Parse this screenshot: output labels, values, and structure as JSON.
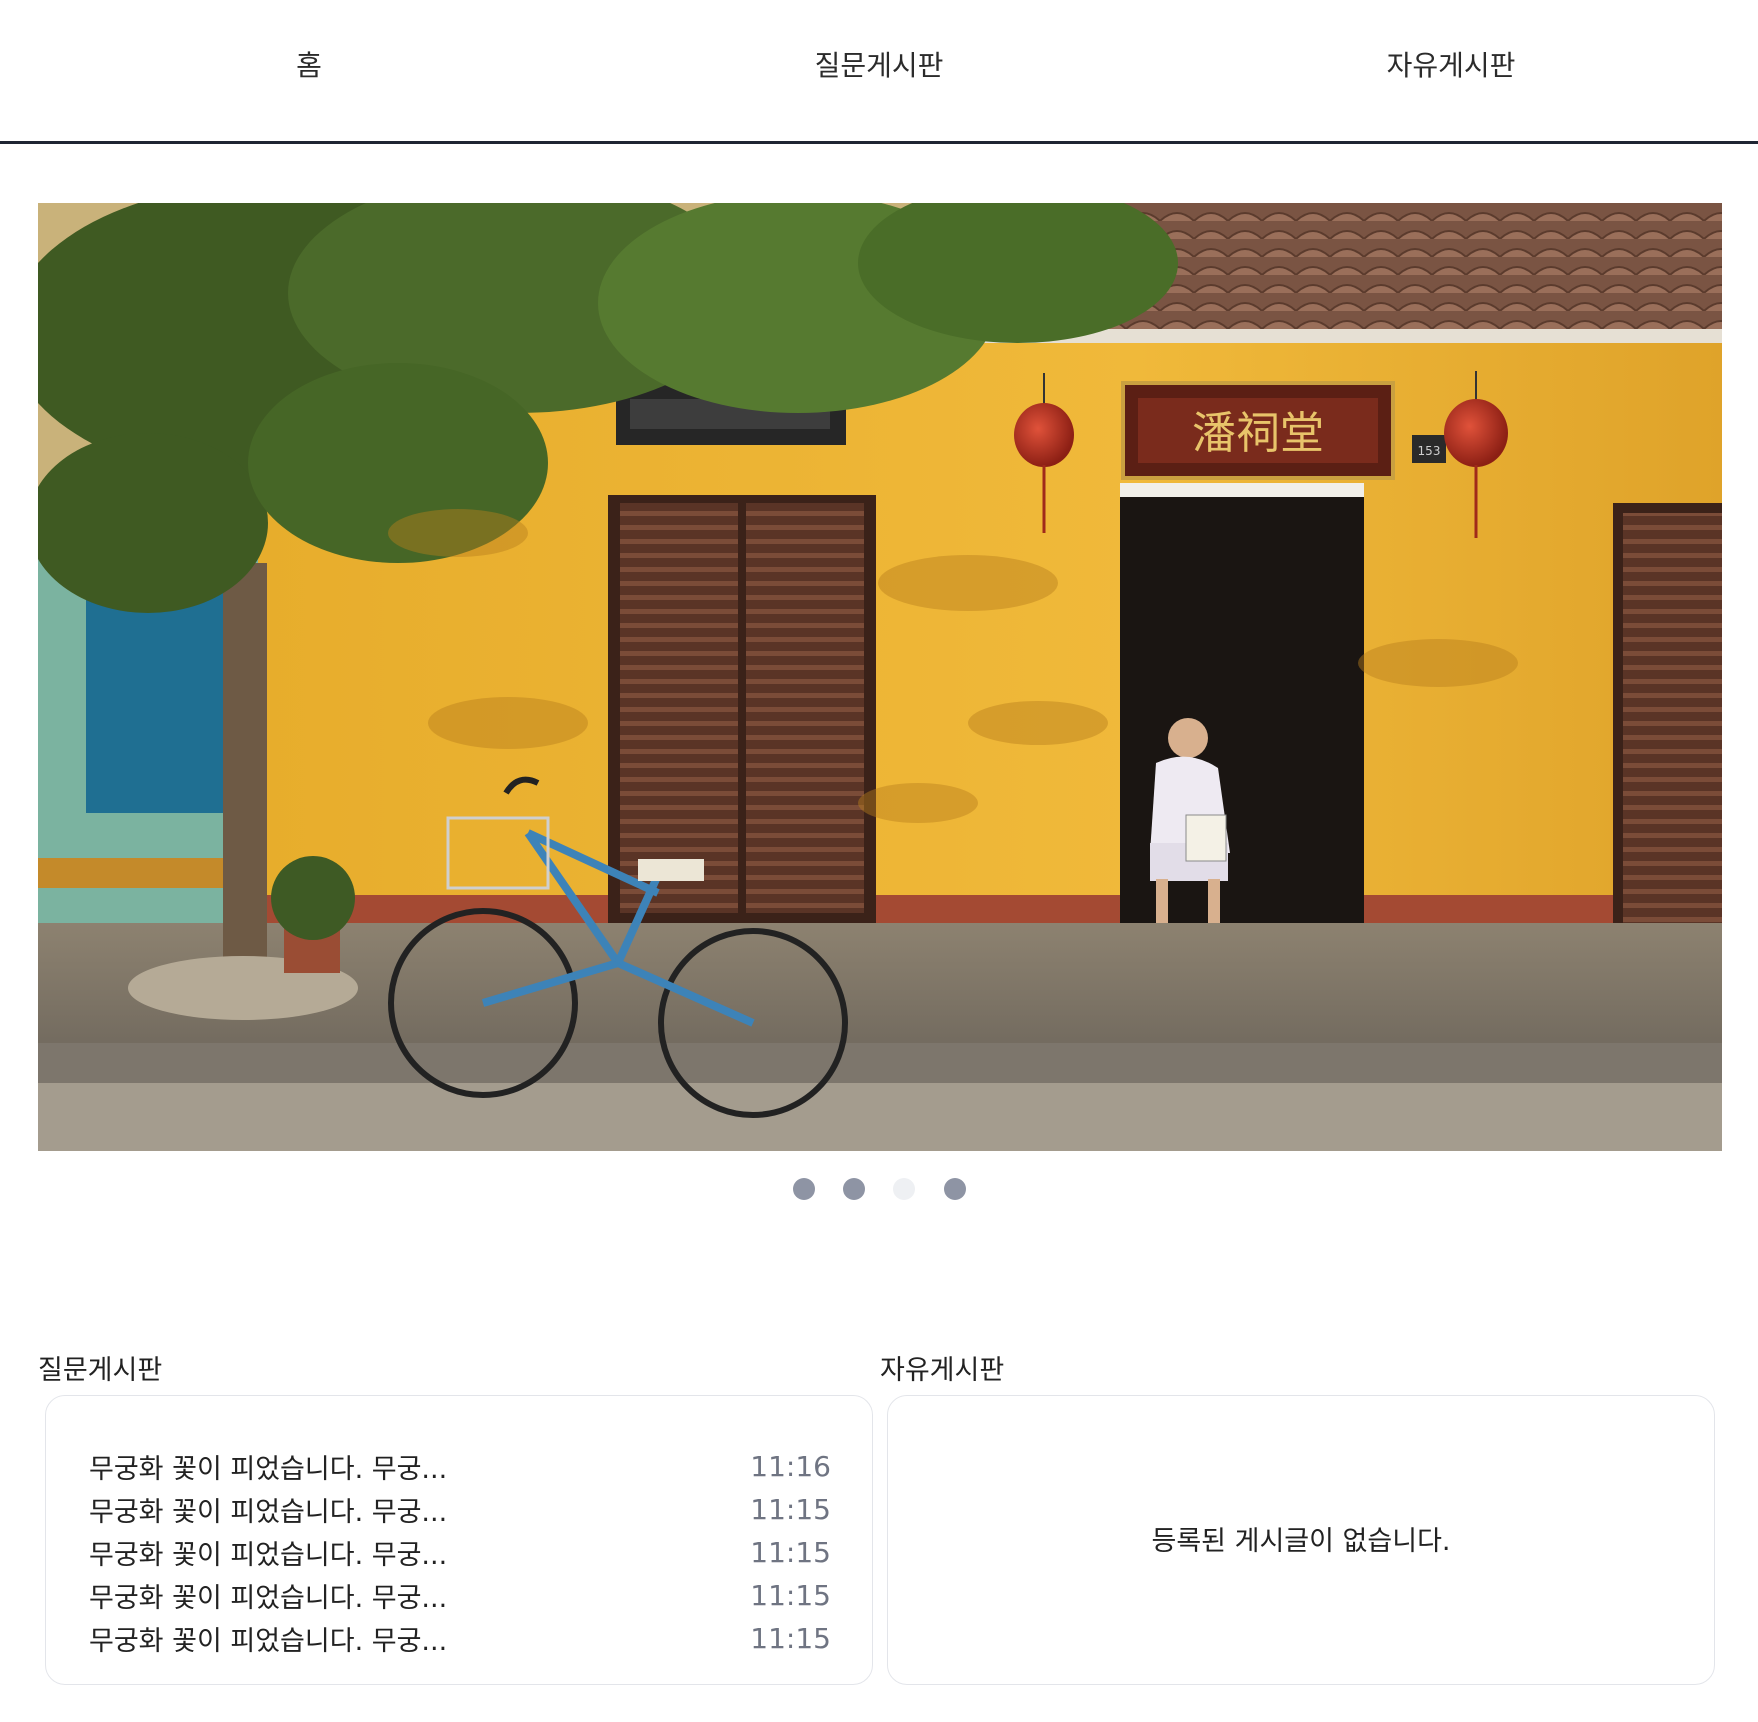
{
  "nav": {
    "home": "홈",
    "qna": "질문게시판",
    "free": "자유게시판"
  },
  "carousel": {
    "slide_count": 4,
    "active_index": 2,
    "image_subject": "yellow building with wooden shutters, tree, blue bicycle and an elderly man reading at a doorway",
    "sign_text": "潘祠堂",
    "house_number": "153"
  },
  "boards": {
    "qna": {
      "title": "질문게시판",
      "posts": [
        {
          "title": "무궁화 꽃이 피었습니다. 무궁...",
          "time": "11:16"
        },
        {
          "title": "무궁화 꽃이 피었습니다. 무궁...",
          "time": "11:15"
        },
        {
          "title": "무궁화 꽃이 피었습니다. 무궁...",
          "time": "11:15"
        },
        {
          "title": "무궁화 꽃이 피었습니다. 무궁...",
          "time": "11:15"
        },
        {
          "title": "무궁화 꽃이 피었습니다. 무궁...",
          "time": "11:15"
        }
      ]
    },
    "free": {
      "title": "자유게시판",
      "empty_message": "등록된 게시글이 없습니다."
    }
  },
  "colors": {
    "nav_border": "#1f2533",
    "dot_inactive": "#8e94a4",
    "dot_active": "#eef0f3",
    "time_text": "#6f7482",
    "card_border": "#e3e5ea"
  }
}
